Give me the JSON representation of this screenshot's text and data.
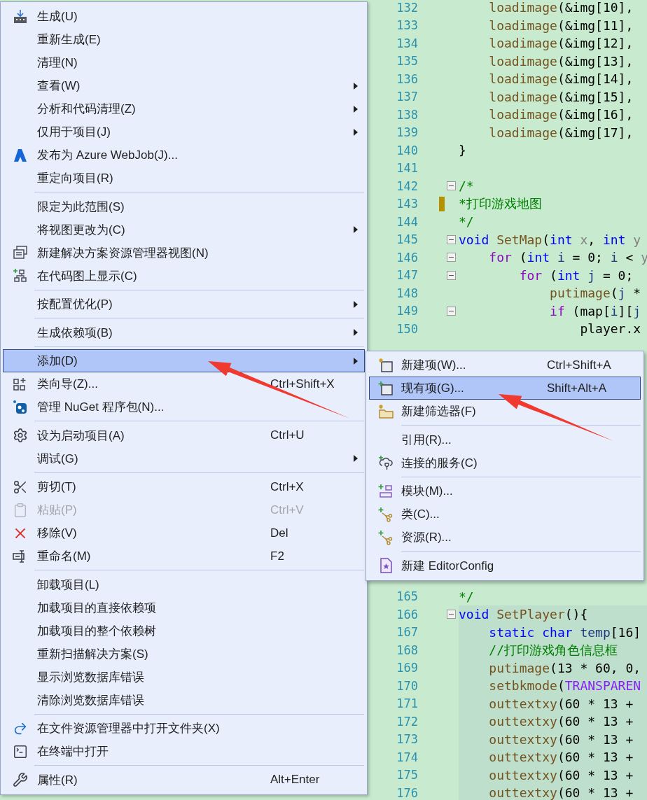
{
  "context_menu": {
    "items": [
      {
        "kind": "item",
        "label": "生成(U)",
        "submenu": false,
        "disabled": false,
        "selected": false
      },
      {
        "kind": "item",
        "label": "重新生成(E)",
        "submenu": false,
        "disabled": false,
        "selected": false
      },
      {
        "kind": "item",
        "label": "清理(N)",
        "submenu": false,
        "disabled": false,
        "selected": false
      },
      {
        "kind": "item",
        "label": "查看(W)",
        "submenu": true,
        "disabled": false,
        "selected": false
      },
      {
        "kind": "item",
        "label": "分析和代码清理(Z)",
        "submenu": true,
        "disabled": false,
        "selected": false
      },
      {
        "kind": "item",
        "label": "仅用于项目(J)",
        "submenu": true,
        "disabled": false,
        "selected": false
      },
      {
        "kind": "item",
        "label": "发布为 Azure WebJob(J)...",
        "submenu": false,
        "disabled": false,
        "selected": false
      },
      {
        "kind": "item",
        "label": "重定向项目(R)",
        "submenu": false,
        "disabled": false,
        "selected": false
      },
      {
        "kind": "separator"
      },
      {
        "kind": "item",
        "label": "限定为此范围(S)",
        "submenu": false,
        "disabled": false,
        "selected": false
      },
      {
        "kind": "item",
        "label": "将视图更改为(C)",
        "submenu": true,
        "disabled": false,
        "selected": false
      },
      {
        "kind": "item",
        "label": "新建解决方案资源管理器视图(N)",
        "submenu": false,
        "disabled": false,
        "selected": false
      },
      {
        "kind": "item",
        "label": "在代码图上显示(C)",
        "submenu": false,
        "disabled": false,
        "selected": false
      },
      {
        "kind": "separator"
      },
      {
        "kind": "item",
        "label": "按配置优化(P)",
        "submenu": true,
        "disabled": false,
        "selected": false
      },
      {
        "kind": "separator"
      },
      {
        "kind": "item",
        "label": "生成依赖项(B)",
        "submenu": true,
        "disabled": false,
        "selected": false
      },
      {
        "kind": "separator"
      },
      {
        "kind": "item",
        "label": "添加(D)",
        "submenu": true,
        "disabled": false,
        "selected": true
      },
      {
        "kind": "item",
        "label": "类向导(Z)...",
        "shortcut": "Ctrl+Shift+X",
        "submenu": false,
        "disabled": false,
        "selected": false
      },
      {
        "kind": "item",
        "label": "管理 NuGet 程序包(N)...",
        "submenu": false,
        "disabled": false,
        "selected": false
      },
      {
        "kind": "separator"
      },
      {
        "kind": "item",
        "label": "设为启动项目(A)",
        "shortcut": "Ctrl+U",
        "submenu": false,
        "disabled": false,
        "selected": false
      },
      {
        "kind": "item",
        "label": "调试(G)",
        "submenu": true,
        "disabled": false,
        "selected": false
      },
      {
        "kind": "separator"
      },
      {
        "kind": "item",
        "label": "剪切(T)",
        "shortcut": "Ctrl+X",
        "submenu": false,
        "disabled": false,
        "selected": false
      },
      {
        "kind": "item",
        "label": "粘贴(P)",
        "shortcut": "Ctrl+V",
        "submenu": false,
        "disabled": true,
        "selected": false
      },
      {
        "kind": "item",
        "label": "移除(V)",
        "shortcut": "Del",
        "submenu": false,
        "disabled": false,
        "selected": false
      },
      {
        "kind": "item",
        "label": "重命名(M)",
        "shortcut": "F2",
        "submenu": false,
        "disabled": false,
        "selected": false
      },
      {
        "kind": "separator"
      },
      {
        "kind": "item",
        "label": "卸载项目(L)",
        "submenu": false,
        "disabled": false,
        "selected": false
      },
      {
        "kind": "item",
        "label": "加载项目的直接依赖项",
        "submenu": false,
        "disabled": false,
        "selected": false
      },
      {
        "kind": "item",
        "label": "加载项目的整个依赖树",
        "submenu": false,
        "disabled": false,
        "selected": false
      },
      {
        "kind": "item",
        "label": "重新扫描解决方案(S)",
        "submenu": false,
        "disabled": false,
        "selected": false
      },
      {
        "kind": "item",
        "label": "显示浏览数据库错误",
        "submenu": false,
        "disabled": false,
        "selected": false
      },
      {
        "kind": "item",
        "label": "清除浏览数据库错误",
        "submenu": false,
        "disabled": false,
        "selected": false
      },
      {
        "kind": "separator"
      },
      {
        "kind": "item",
        "label": "在文件资源管理器中打开文件夹(X)",
        "submenu": false,
        "disabled": false,
        "selected": false
      },
      {
        "kind": "item",
        "label": "在终端中打开",
        "submenu": false,
        "disabled": false,
        "selected": false
      },
      {
        "kind": "separator"
      },
      {
        "kind": "item",
        "label": "属性(R)",
        "shortcut": "Alt+Enter",
        "submenu": false,
        "disabled": false,
        "selected": false
      }
    ]
  },
  "submenu": {
    "items": [
      {
        "kind": "item",
        "label": "新建项(W)...",
        "shortcut": "Ctrl+Shift+A",
        "selected": false
      },
      {
        "kind": "item",
        "label": "现有项(G)...",
        "shortcut": "Shift+Alt+A",
        "selected": true
      },
      {
        "kind": "item",
        "label": "新建筛选器(F)",
        "selected": false
      },
      {
        "kind": "separator"
      },
      {
        "kind": "item",
        "label": "引用(R)...",
        "selected": false
      },
      {
        "kind": "item",
        "label": "连接的服务(C)",
        "selected": false
      },
      {
        "kind": "separator"
      },
      {
        "kind": "item",
        "label": "模块(M)...",
        "selected": false
      },
      {
        "kind": "item",
        "label": "类(C)...",
        "selected": false
      },
      {
        "kind": "item",
        "label": "资源(R)...",
        "selected": false
      },
      {
        "kind": "separator"
      },
      {
        "kind": "item",
        "label": "新建 EditorConfig",
        "selected": false
      }
    ]
  },
  "editor": {
    "sections": [
      {
        "lines": [
          {
            "n": "132",
            "collapsible": false,
            "tokens": [
              {
                "t": "    loadimage",
                "kind": "fn"
              },
              {
                "t": "(&img[10],",
                "kind": "plain"
              }
            ]
          },
          {
            "n": "133",
            "collapsible": false,
            "tokens": [
              {
                "t": "    loadimage",
                "kind": "fn"
              },
              {
                "t": "(&img[11],",
                "kind": "plain"
              }
            ]
          },
          {
            "n": "134",
            "collapsible": false,
            "tokens": [
              {
                "t": "    loadimage",
                "kind": "fn"
              },
              {
                "t": "(&img[12],",
                "kind": "plain"
              }
            ]
          },
          {
            "n": "135",
            "collapsible": false,
            "tokens": [
              {
                "t": "    loadimage",
                "kind": "fn"
              },
              {
                "t": "(&img[13],",
                "kind": "plain"
              }
            ]
          },
          {
            "n": "136",
            "collapsible": false,
            "tokens": [
              {
                "t": "    loadimage",
                "kind": "fn"
              },
              {
                "t": "(&img[14],",
                "kind": "plain"
              }
            ]
          },
          {
            "n": "137",
            "collapsible": false,
            "tokens": [
              {
                "t": "    loadimage",
                "kind": "fn"
              },
              {
                "t": "(&img[15],",
                "kind": "plain"
              }
            ]
          },
          {
            "n": "138",
            "collapsible": false,
            "tokens": [
              {
                "t": "    loadimage",
                "kind": "fn"
              },
              {
                "t": "(&img[16],",
                "kind": "plain"
              }
            ]
          },
          {
            "n": "139",
            "collapsible": false,
            "tokens": [
              {
                "t": "    loadimage",
                "kind": "fn"
              },
              {
                "t": "(&img[17],",
                "kind": "plain"
              }
            ]
          },
          {
            "n": "140",
            "collapsible": false,
            "tokens": [
              {
                "t": "}",
                "kind": "plain"
              }
            ]
          },
          {
            "n": "141",
            "collapsible": false
          },
          {
            "n": "142",
            "collapsible": true,
            "tokens": [
              {
                "t": "/*",
                "kind": "cmt"
              }
            ]
          },
          {
            "n": "143",
            "collapsible": false,
            "changed": true,
            "tokens": [
              {
                "t": "*打印游戏地图",
                "kind": "cmt"
              }
            ]
          },
          {
            "n": "144",
            "collapsible": false,
            "tokens": [
              {
                "t": "*/",
                "kind": "cmt"
              }
            ]
          },
          {
            "n": "145",
            "collapsible": true,
            "tokens": [
              {
                "t": "void ",
                "kind": "kw"
              },
              {
                "t": "SetMap",
                "kind": "fn"
              },
              {
                "t": "(",
                "kind": "plain"
              },
              {
                "t": "int",
                "kind": "kw"
              },
              {
                "t": " x",
                "kind": "param"
              },
              {
                "t": ", ",
                "kind": "plain"
              },
              {
                "t": "int",
                "kind": "kw"
              },
              {
                "t": " y",
                "kind": "param"
              }
            ]
          },
          {
            "n": "146",
            "collapsible": true,
            "tokens": [
              {
                "t": "    for",
                "kind": "ctl"
              },
              {
                "t": " (",
                "kind": "plain"
              },
              {
                "t": "int",
                "kind": "kw"
              },
              {
                "t": " i",
                "kind": "local"
              },
              {
                "t": " = 0; ",
                "kind": "plain"
              },
              {
                "t": "i",
                "kind": "local"
              },
              {
                "t": " < ",
                "kind": "plain"
              },
              {
                "t": "y",
                "kind": "param"
              }
            ]
          },
          {
            "n": "147",
            "collapsible": true,
            "tokens": [
              {
                "t": "        for",
                "kind": "ctl"
              },
              {
                "t": " (",
                "kind": "plain"
              },
              {
                "t": "int",
                "kind": "kw"
              },
              {
                "t": " j",
                "kind": "local"
              },
              {
                "t": " = 0;",
                "kind": "plain"
              }
            ]
          },
          {
            "n": "148",
            "collapsible": false,
            "tokens": [
              {
                "t": "            putimage",
                "kind": "fn"
              },
              {
                "t": "(",
                "kind": "plain"
              },
              {
                "t": "j",
                "kind": "local"
              },
              {
                "t": " *",
                "kind": "plain"
              }
            ]
          },
          {
            "n": "149",
            "collapsible": true,
            "tokens": [
              {
                "t": "            if",
                "kind": "ctl"
              },
              {
                "t": " (map[",
                "kind": "plain"
              },
              {
                "t": "i",
                "kind": "local"
              },
              {
                "t": "][",
                "kind": "plain"
              },
              {
                "t": "j",
                "kind": "local"
              }
            ]
          },
          {
            "n": "150",
            "collapsible": false,
            "tokens": [
              {
                "t": "                player.x",
                "kind": "plain"
              }
            ]
          }
        ]
      },
      {
        "lines": [
          {
            "n": "165",
            "collapsible": false,
            "tokens": [
              {
                "t": "*/",
                "kind": "cmt"
              }
            ]
          },
          {
            "n": "166",
            "collapsible": true,
            "highlighted": true,
            "tokens": [
              {
                "t": "void ",
                "kind": "kw"
              },
              {
                "t": "SetPlayer",
                "kind": "fn"
              },
              {
                "t": "(){",
                "kind": "plain"
              }
            ]
          },
          {
            "n": "167",
            "collapsible": false,
            "highlighted": true,
            "tokens": [
              {
                "t": "    static char ",
                "kind": "kw"
              },
              {
                "t": "temp",
                "kind": "local"
              },
              {
                "t": "[16]",
                "kind": "plain"
              }
            ]
          },
          {
            "n": "168",
            "collapsible": false,
            "highlighted": true,
            "tokens": [
              {
                "t": "    //打印游戏角色信息框",
                "kind": "cmt"
              }
            ]
          },
          {
            "n": "169",
            "collapsible": false,
            "highlighted": true,
            "tokens": [
              {
                "t": "    putimage",
                "kind": "fn"
              },
              {
                "t": "(13 * 60, 0,",
                "kind": "plain"
              }
            ]
          },
          {
            "n": "170",
            "collapsible": false,
            "highlighted": true,
            "tokens": [
              {
                "t": "    setbkmode",
                "kind": "fn"
              },
              {
                "t": "(",
                "kind": "plain"
              },
              {
                "t": "TRANSPAREN",
                "kind": "macro"
              }
            ]
          },
          {
            "n": "171",
            "collapsible": false,
            "highlighted": true,
            "tokens": [
              {
                "t": "    outtextxy",
                "kind": "fn"
              },
              {
                "t": "(60 * 13 +",
                "kind": "plain"
              }
            ]
          },
          {
            "n": "172",
            "collapsible": false,
            "highlighted": true,
            "tokens": [
              {
                "t": "    outtextxy",
                "kind": "fn"
              },
              {
                "t": "(60 * 13 +",
                "kind": "plain"
              }
            ]
          },
          {
            "n": "173",
            "collapsible": false,
            "highlighted": true,
            "tokens": [
              {
                "t": "    outtextxy",
                "kind": "fn"
              },
              {
                "t": "(60 * 13 +",
                "kind": "plain"
              }
            ]
          },
          {
            "n": "174",
            "collapsible": false,
            "highlighted": true,
            "tokens": [
              {
                "t": "    outtextxy",
                "kind": "fn"
              },
              {
                "t": "(60 * 13 +",
                "kind": "plain"
              }
            ]
          },
          {
            "n": "175",
            "collapsible": false,
            "highlighted": true,
            "tokens": [
              {
                "t": "    outtextxy",
                "kind": "fn"
              },
              {
                "t": "(60 * 13 +",
                "kind": "plain"
              }
            ]
          },
          {
            "n": "176",
            "collapsible": false,
            "highlighted": true,
            "tokens": [
              {
                "t": "    outtextxy",
                "kind": "fn"
              },
              {
                "t": "(60 * 13 +",
                "kind": "plain"
              }
            ]
          }
        ]
      }
    ]
  }
}
